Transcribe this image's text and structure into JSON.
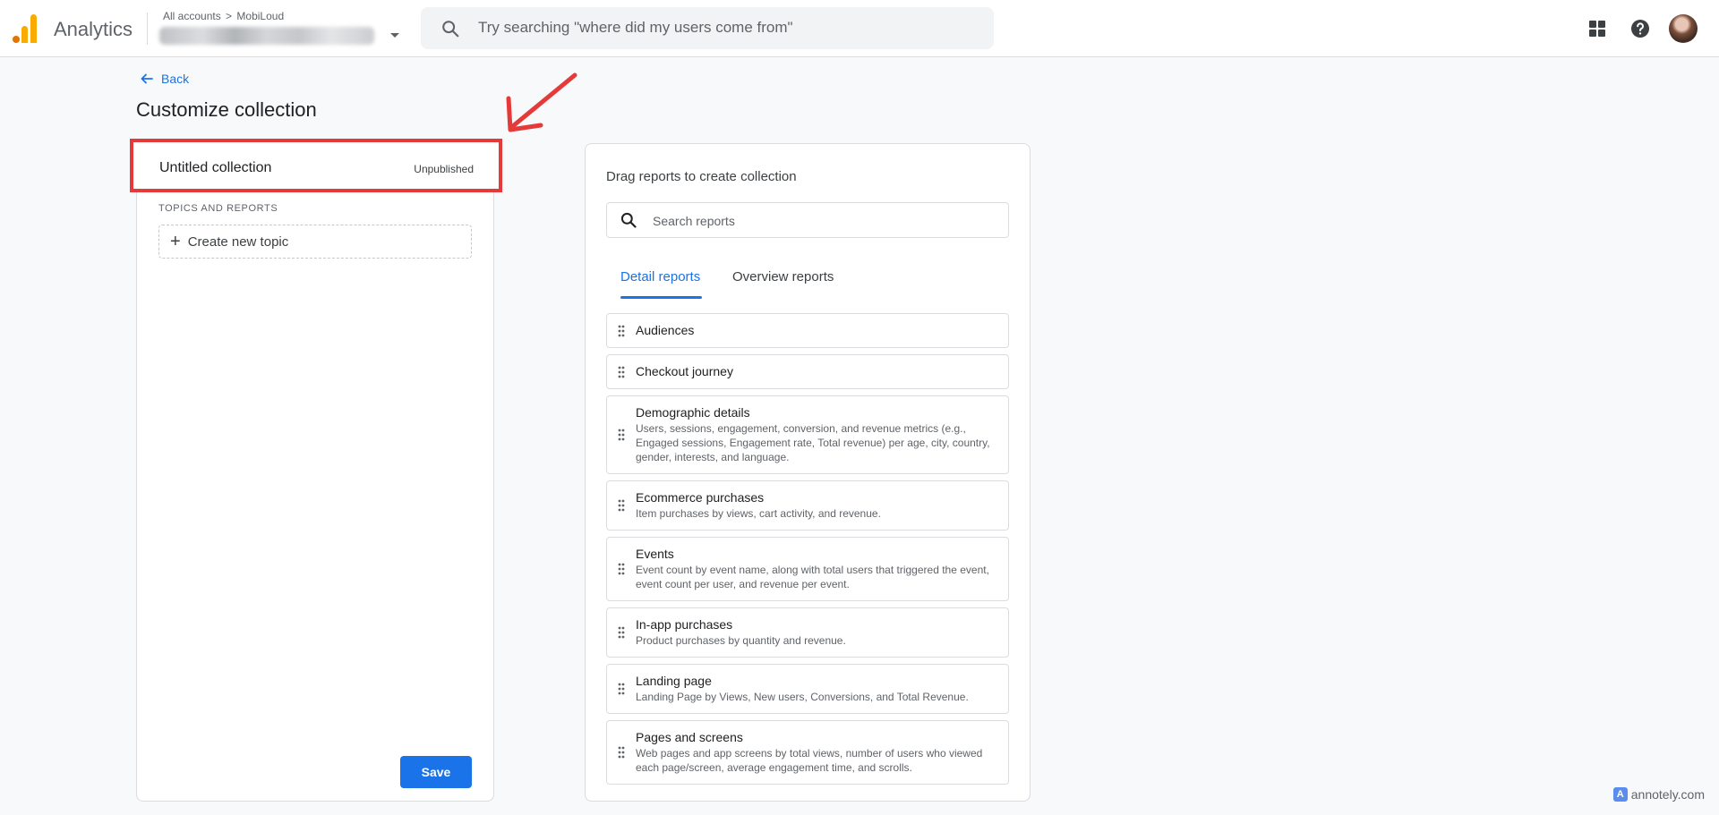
{
  "app": {
    "product_name": "Analytics",
    "account_breadcrumb": {
      "root": "All accounts",
      "separator": ">",
      "account": "MobiLoud"
    },
    "search_placeholder": "Try searching \"where did my users come from\""
  },
  "page": {
    "back_label": "Back",
    "title": "Customize collection"
  },
  "collection": {
    "title": "Untitled collection",
    "status": "Unpublished",
    "section_label": "TOPICS AND REPORTS",
    "create_topic_label": "Create new topic",
    "save_label": "Save"
  },
  "library": {
    "title": "Drag reports to create collection",
    "search_placeholder": "Search reports",
    "tabs": [
      {
        "label": "Detail reports",
        "active": true
      },
      {
        "label": "Overview reports",
        "active": false
      }
    ],
    "reports": [
      {
        "name": "Audiences",
        "desc": ""
      },
      {
        "name": "Checkout journey",
        "desc": ""
      },
      {
        "name": "Demographic details",
        "desc": "Users, sessions, engagement, conversion, and revenue metrics (e.g., Engaged sessions, Engagement rate, Total revenue) per age, city, country, gender, interests, and language."
      },
      {
        "name": "Ecommerce purchases",
        "desc": "Item purchases by views, cart activity, and revenue."
      },
      {
        "name": "Events",
        "desc": "Event count by event name, along with total users that triggered the event, event count per user, and revenue per event."
      },
      {
        "name": "In-app purchases",
        "desc": "Product purchases by quantity and revenue."
      },
      {
        "name": "Landing page",
        "desc": "Landing Page by Views, New users, Conversions, and Total Revenue."
      },
      {
        "name": "Pages and screens",
        "desc": "Web pages and app screens by total views, number of users who viewed each page/screen, average engagement time, and scrolls."
      }
    ]
  },
  "watermark": {
    "text": "annotely.com"
  },
  "colors": {
    "accent": "#1a73e8",
    "annotation": "#e53a3a",
    "logo_orange": "#f9ab00"
  },
  "icons": [
    "analytics-logo-icon",
    "search-icon",
    "apps-grid-icon",
    "help-icon",
    "arrow-back-icon",
    "plus-icon",
    "drag-handle-icon",
    "annotation-arrow-icon"
  ]
}
